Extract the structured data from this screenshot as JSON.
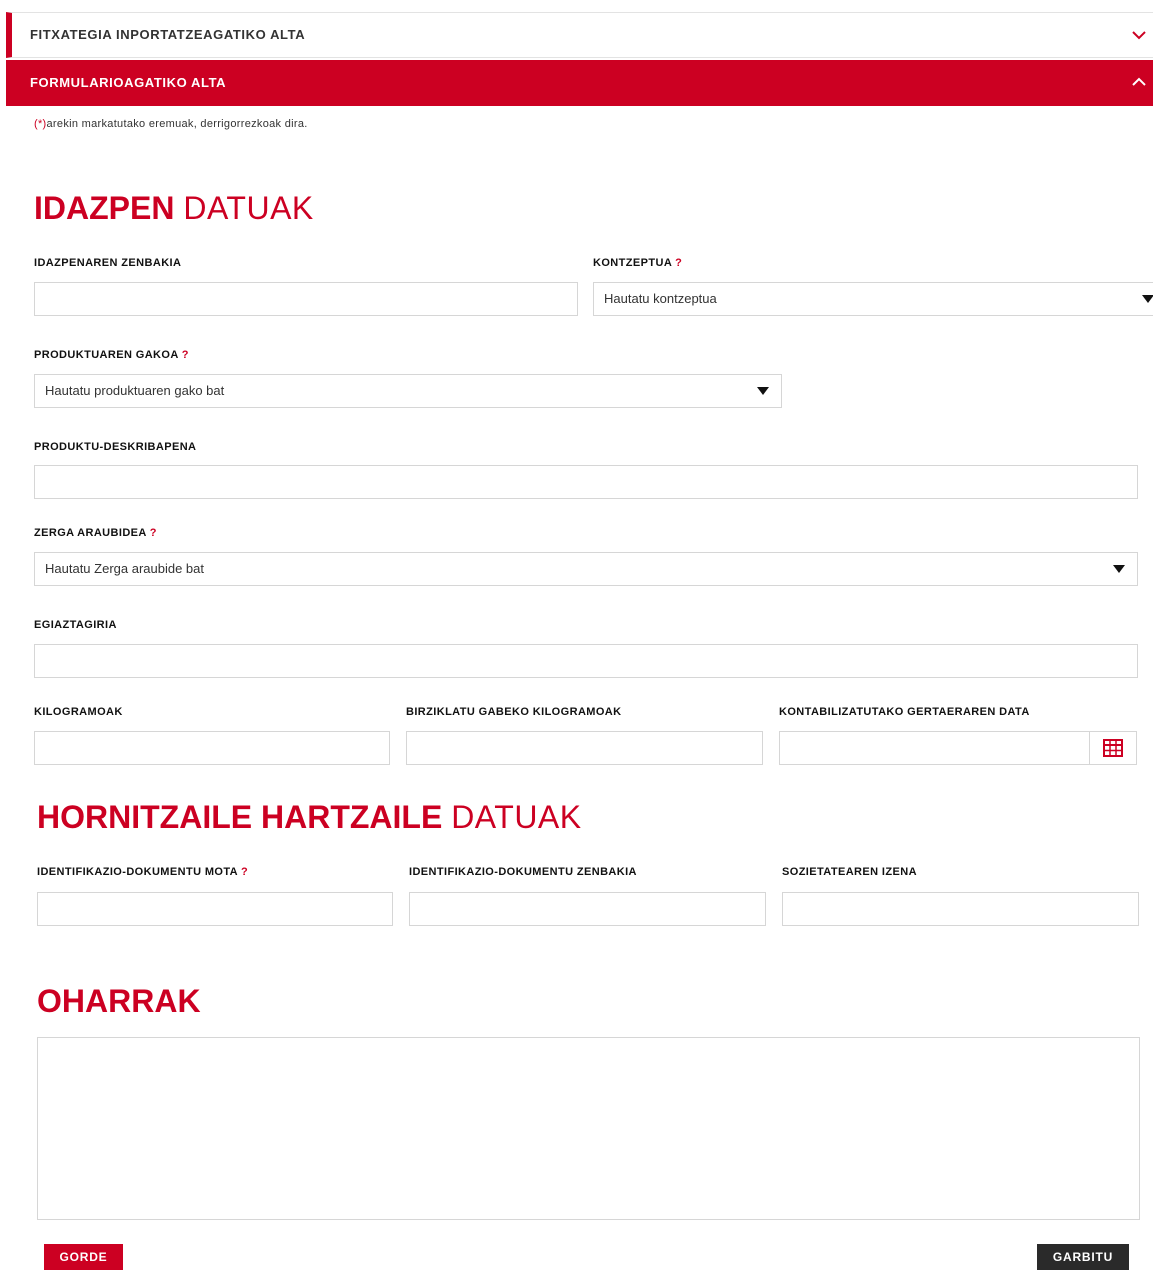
{
  "accordion": {
    "import_title": "FITXATEGIA INPORTATZEAGATIKO ALTA",
    "form_title": "FORMULARIOAGATIKO ALTA"
  },
  "required_note": {
    "star": "(*)",
    "text": "arekin markatutako eremuak, derrigorrezkoak dira."
  },
  "section_record": {
    "title_bold": "IDAZPEN",
    "title_light": "DATUAK"
  },
  "fields": {
    "record_number": {
      "label": "IDAZPENAREN ZENBAKIA"
    },
    "concept": {
      "label": "KONTZEPTUA",
      "mark": "?",
      "selected": "Hautatu kontzeptua"
    },
    "product_key": {
      "label": "PRODUKTUAREN GAKOA",
      "mark": "?",
      "selected": "Hautatu produktuaren gako bat"
    },
    "product_description": {
      "label": "PRODUKTU-DESKRIBAPENA"
    },
    "tax_regime": {
      "label": "ZERGA ARAUBIDEA",
      "mark": "?",
      "selected": "Hautatu Zerga araubide bat"
    },
    "receipt": {
      "label": "EGIAZTAGIRIA"
    },
    "kilograms": {
      "label": "KILOGRAMOAK"
    },
    "non_recycled_kilograms": {
      "label": "BIRZIKLATU GABEKO KILOGRAMOAK"
    },
    "event_date": {
      "label": "KONTABILIZATUTAKO GERTAERAREN DATA"
    }
  },
  "section_supplier": {
    "title_bold": "HORNITZAILE HARTZAILE",
    "title_light": "DATUAK"
  },
  "supplier_fields": {
    "id_doc_type": {
      "label": "IDENTIFIKAZIO-DOKUMENTU MOTA",
      "mark": "?"
    },
    "id_doc_number": {
      "label": "IDENTIFIKAZIO-DOKUMENTU ZENBAKIA"
    },
    "company_name": {
      "label": "SOZIETATEAREN IZENA"
    }
  },
  "section_notes": {
    "title_bold": "OHARRAK"
  },
  "buttons": {
    "save": "GORDE",
    "clear": "GARBITU"
  },
  "colors": {
    "accent": "#cc0022",
    "dark_button": "#2a2a2a",
    "border": "#d6d6d6"
  },
  "icons": {
    "collapsed": "chevron-down-icon",
    "expanded": "chevron-up-icon",
    "date": "calendar-icon"
  }
}
